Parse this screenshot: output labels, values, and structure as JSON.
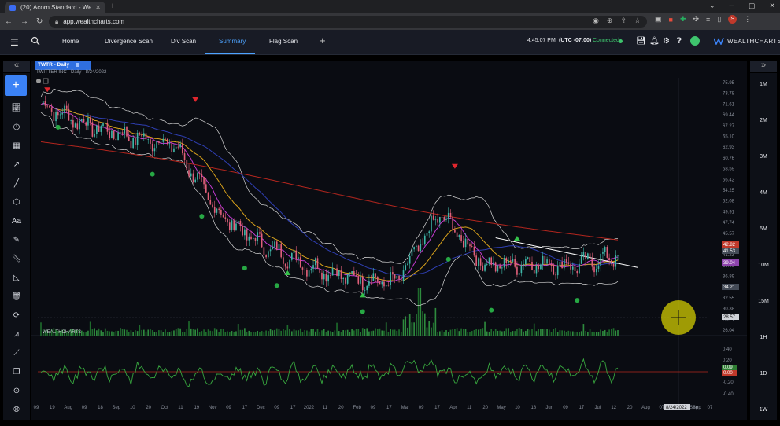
{
  "browser": {
    "tab_title": "(20) Acorn Standard - WealthCh...",
    "new_tab": "+",
    "url": "app.wealthcharts.com",
    "profile_initial": "S"
  },
  "nav": {
    "tabs": [
      "Home",
      "Divergence Scan",
      "Div Scan",
      "Summary",
      "Flag Scan"
    ],
    "active_tab": "Summary",
    "add_tab": "+",
    "clock": "4:45:07 PM",
    "timezone": "(UTC -07:00)",
    "connection": "Connected",
    "logo": "WEALTHCHARTS"
  },
  "panels": {
    "collapse_left": "«",
    "collapse_right": "»"
  },
  "chart": {
    "tab_label": "TWTR - Daily",
    "subtitle": "TWITTER INC - Daily - 8/24/2022",
    "volume_logo": "WEALTHCHARTS",
    "price_ticks": [
      "75.95",
      "73.78",
      "71.61",
      "69.44",
      "67.27",
      "65.10",
      "62.93",
      "60.76",
      "58.59",
      "56.42",
      "54.25",
      "52.08",
      "49.91",
      "47.74",
      "45.57",
      "43.40",
      "41.23",
      "39.06",
      "36.89",
      "34.72",
      "32.55",
      "30.38",
      "28.21",
      "26.04"
    ],
    "price_badges": [
      {
        "label": "42.82",
        "color": "#c0392b"
      },
      {
        "label": "41.53",
        "color": "#444b57"
      },
      {
        "label": "39.04",
        "color": "#8e44ad"
      },
      {
        "label": "34.21",
        "color": "#444b57"
      }
    ],
    "crosshair_price": "28.57",
    "osc_ticks": [
      "0.40",
      "0.20",
      "-0.20",
      "-0.40"
    ],
    "osc_badges": [
      {
        "label": "0.09",
        "color": "#2e7d32"
      },
      {
        "label": "0.00",
        "color": "#c0392b"
      }
    ],
    "x_labels": [
      "09",
      "19",
      "Aug",
      "09",
      "18",
      "Sep",
      "10",
      "20",
      "Oct",
      "11",
      "19",
      "Nov",
      "09",
      "17",
      "Dec",
      "09",
      "17",
      "2022",
      "11",
      "20",
      "Feb",
      "09",
      "17",
      "Mar",
      "09",
      "17",
      "Apr",
      "11",
      "20",
      "May",
      "10",
      "18",
      "Jun",
      "09",
      "17",
      "Jul",
      "12",
      "20",
      "Aug",
      "07",
      "13",
      "Sep",
      "07"
    ],
    "crosshair_date": "8/24/2022",
    "crosshair_date_after": "Sep",
    "line_colors": {
      "sma200": "#b3261e",
      "sma50": "#2f3fb3",
      "sma20": "#d9a21b",
      "fast": "#c43bd1",
      "bollinger": "#d6d6d6",
      "trend": "#ffffff"
    }
  },
  "chart_data": {
    "type": "candlestick",
    "title": "TWITTER INC - Daily - 8/24/2022",
    "ylim": [
      26.04,
      75.95
    ],
    "price_path": [
      [
        "Jul 2021",
        70.5
      ],
      [
        "Aug 2021",
        66.5
      ],
      [
        "Sep 2021",
        64.0
      ],
      [
        "Oct 2021",
        62.5
      ],
      [
        "Nov 2021",
        48.5
      ],
      [
        "Dec 2021",
        42.0
      ],
      [
        "Jan 2022",
        38.0
      ],
      [
        "Feb 2022",
        35.5
      ],
      [
        "Mar 2022",
        34.5
      ],
      [
        "Apr 2022",
        48.5
      ],
      [
        "May 2022",
        38.0
      ],
      [
        "Jun 2022",
        38.5
      ],
      [
        "Jul 2022",
        38.0
      ],
      [
        "Aug 2022",
        40.0
      ]
    ],
    "oscillator_ylim": [
      -0.45,
      0.45
    ]
  },
  "intervals": [
    "1M",
    "2M",
    "3M",
    "4M",
    "5M",
    "10M",
    "15M",
    "1H",
    "1D",
    "1W"
  ]
}
